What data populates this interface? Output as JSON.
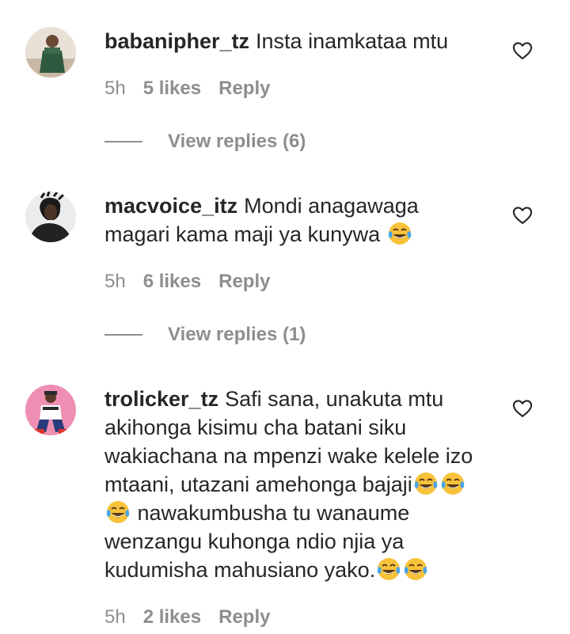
{
  "comments": [
    {
      "username": "babanipher_tz",
      "text": "Insta inamkataa mtu",
      "time": "5h",
      "likes": "5 likes",
      "reply": "Reply",
      "view_replies": "View replies (6)"
    },
    {
      "username": "macvoice_itz",
      "text_line1": "Mondi anagawaga",
      "text_line2": "magari kama maji ya kunywa",
      "time": "5h",
      "likes": "6 likes",
      "reply": "Reply",
      "view_replies": "View replies (1)"
    },
    {
      "username": "trolicker_tz",
      "text_line1": "Safi sana, unakuta mtu",
      "text_line2": "akihonga kisimu cha batani siku",
      "text_line3": "wakiachana na mpenzi wake kelele izo",
      "text_line4": "mtaani, utazani amehonga bajaji",
      "text_line5": "nawakumbusha tu wanaume",
      "text_line6": "wenzangu kuhonga ndio njia ya",
      "text_line7": "kudumisha mahusiano yako.",
      "time": "5h",
      "likes": "2 likes",
      "reply": "Reply"
    }
  ],
  "icons": {
    "like": "heart-outline-icon",
    "emoji": "face-with-tears-of-joy-emoji"
  },
  "colors": {
    "text": "#262626",
    "secondary": "#8e8e8e",
    "background": "#ffffff"
  }
}
